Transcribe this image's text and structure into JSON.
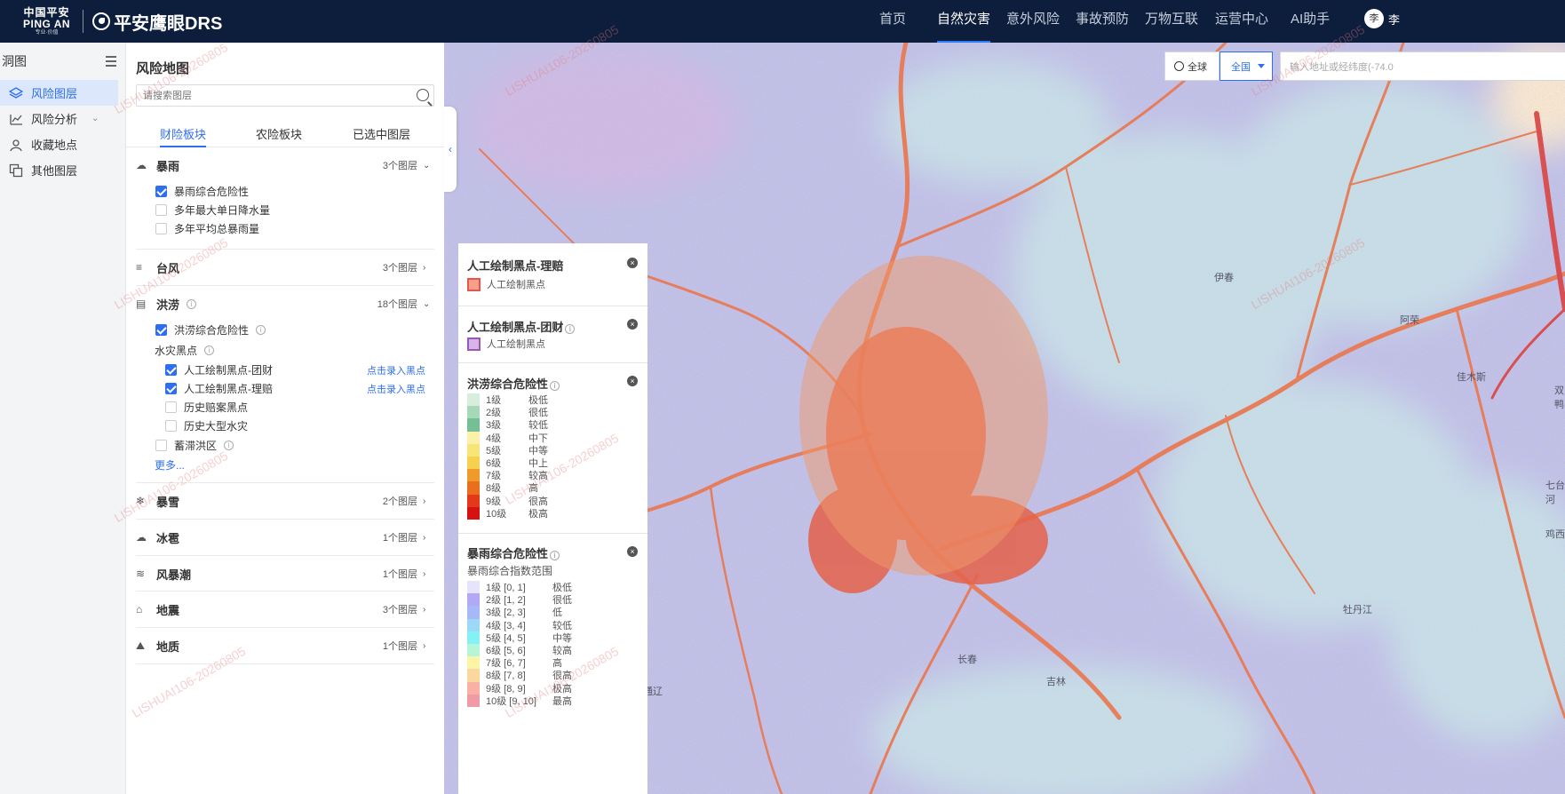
{
  "header": {
    "company_cn": "中国平安",
    "company_en": "PING AN",
    "company_tag": "专业·价值",
    "product_name": "平安鹰眼DRS",
    "nav": [
      {
        "label": "首页",
        "active": false
      },
      {
        "label": "自然灾害",
        "active": true
      },
      {
        "label": "意外风险",
        "active": false
      },
      {
        "label": "事故预防",
        "active": false
      },
      {
        "label": "万物互联",
        "active": false
      },
      {
        "label": "运营中心",
        "active": false
      },
      {
        "label": "AI助手",
        "active": false
      }
    ],
    "avatar_initial": "李",
    "avatar_name_partial": "李"
  },
  "leftnav": {
    "title": "洞图",
    "items": [
      {
        "label": "风险图层",
        "icon": "layers-icon",
        "active": true
      },
      {
        "label": "风险分析",
        "icon": "chart-icon",
        "active": false,
        "has_submenu": true
      },
      {
        "label": "收藏地点",
        "icon": "location-pin-icon",
        "active": false
      },
      {
        "label": "其他图层",
        "icon": "stack-icon",
        "active": false
      }
    ]
  },
  "panel": {
    "title": "风险地图",
    "search_placeholder": "请搜索图层",
    "tabs": [
      {
        "label": "财险板块",
        "active": true
      },
      {
        "label": "农险板块",
        "active": false
      },
      {
        "label": "已选中图层",
        "active": false
      }
    ],
    "groups": {
      "rainstorm": {
        "name": "暴雨",
        "count": "3个图层",
        "expanded": true,
        "layers": [
          {
            "label": "暴雨综合危险性",
            "checked": true
          },
          {
            "label": "多年最大单日降水量",
            "checked": false
          },
          {
            "label": "多年平均总暴雨量",
            "checked": false
          }
        ]
      },
      "typhoon": {
        "name": "台风",
        "count": "3个图层",
        "expanded": false
      },
      "flood": {
        "name": "洪涝",
        "count": "18个图层",
        "expanded": true,
        "main_layer": {
          "label": "洪涝综合危险性",
          "checked": true
        },
        "subgroup_label": "水灾黑点",
        "sub_layers": [
          {
            "label": "人工绘制黑点-团财",
            "checked": true,
            "action": "点击录入黑点"
          },
          {
            "label": "人工绘制黑点-理赔",
            "checked": true,
            "action": "点击录入黑点"
          },
          {
            "label": "历史赔案黑点",
            "checked": false
          },
          {
            "label": "历史大型水灾",
            "checked": false
          }
        ],
        "extra_layer": {
          "label": "蓄滞洪区",
          "checked": false
        },
        "more": "更多..."
      },
      "snowstorm": {
        "name": "暴雪",
        "count": "2个图层",
        "expanded": false
      },
      "hail": {
        "name": "冰雹",
        "count": "1个图层",
        "expanded": false
      },
      "storm_surge": {
        "name": "风暴潮",
        "count": "1个图层",
        "expanded": false
      },
      "earthquake": {
        "name": "地震",
        "count": "3个图层",
        "expanded": false
      },
      "geology": {
        "name": "地质",
        "count": "1个图层",
        "expanded": false
      }
    }
  },
  "map": {
    "scope_label": "全球",
    "region_label": "全国",
    "address_placeholder": "输入地址或经纬度(-74.0",
    "place_labels": [
      "伊春",
      "佳木斯",
      "双鸭",
      "七台河",
      "鸡西",
      "牡丹江",
      "长春",
      "吉林",
      "通辽",
      "阿荣"
    ]
  },
  "legend": {
    "claims": {
      "title": "人工绘制黑点-理赔",
      "item": "人工绘制黑点",
      "color": "#f4a08a",
      "border": "#e8554b"
    },
    "group": {
      "title": "人工绘制黑点-团财",
      "item": "人工绘制黑点",
      "color": "#d8b4e8",
      "border": "#9b59b6"
    },
    "flood": {
      "title": "洪涝综合危险性",
      "rows": [
        {
          "level": "1级",
          "desc": "极低",
          "color": "#d7eedd"
        },
        {
          "level": "2级",
          "desc": "很低",
          "color": "#a6d9b8"
        },
        {
          "level": "3级",
          "desc": "较低",
          "color": "#74bf96"
        },
        {
          "level": "4级",
          "desc": "中下",
          "color": "#fbf1a8"
        },
        {
          "level": "5级",
          "desc": "中等",
          "color": "#f8e57a"
        },
        {
          "level": "6级",
          "desc": "中上",
          "color": "#f7d04d"
        },
        {
          "level": "7级",
          "desc": "较高",
          "color": "#f19a2c"
        },
        {
          "level": "8级",
          "desc": "高",
          "color": "#eb6e1e"
        },
        {
          "level": "9级",
          "desc": "很高",
          "color": "#e3391a"
        },
        {
          "level": "10级",
          "desc": "极高",
          "color": "#d71010"
        }
      ]
    },
    "rain": {
      "title": "暴雨综合危险性",
      "subtitle": "暴雨综合指数范围",
      "rows": [
        {
          "level": "1级 [0, 1]",
          "desc": "极低",
          "color": "#e6e4fb"
        },
        {
          "level": "2级 [1, 2]",
          "desc": "很低",
          "color": "#b1a9f5"
        },
        {
          "level": "3级 [2, 3]",
          "desc": "低",
          "color": "#a6b9f6"
        },
        {
          "level": "4级 [3, 4]",
          "desc": "较低",
          "color": "#9cd9f7"
        },
        {
          "level": "5级 [4, 5]",
          "desc": "中等",
          "color": "#84f1f5"
        },
        {
          "level": "6级 [5, 6]",
          "desc": "较高",
          "color": "#b7f5d8"
        },
        {
          "level": "7级 [6, 7]",
          "desc": "高",
          "color": "#fbf6a6"
        },
        {
          "level": "8级 [7, 8]",
          "desc": "很高",
          "color": "#fcd79d"
        },
        {
          "level": "9级 [8, 9]",
          "desc": "极高",
          "color": "#f8b1a2"
        },
        {
          "level": "10级 [9, 10]",
          "desc": "最高",
          "color": "#f09aa6"
        }
      ]
    }
  },
  "watermark_text": "LISHUAI106-20260805",
  "collapse_arrow": "‹"
}
